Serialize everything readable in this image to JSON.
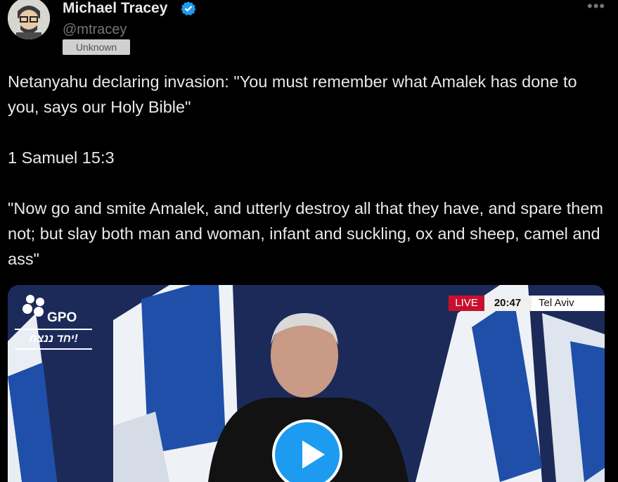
{
  "author": {
    "name": "Michael Tracey",
    "handle": "@mtracey",
    "badge": "Unknown",
    "avatar_icon": "avatar-illustration-icon",
    "verified_icon": "verified-badge-icon"
  },
  "menu": {
    "more_label": "•••"
  },
  "tweet": {
    "line1": "Netanyahu declaring invasion: \"You must remember what Amalek has done to you, says our Holy Bible\"",
    "line2": "1 Samuel 15:3",
    "line3": "\"Now go and smite Amalek, and utterly destroy all that they have, and spare them not; but slay both man and woman, infant and suckling, ox and sheep, camel and ass\""
  },
  "media": {
    "gpo_label": "GPO",
    "hebrew_banner": "יחד ננצח!",
    "live_label": "LIVE",
    "time": "20:47",
    "city": "Tel Aviv",
    "play_icon": "play-icon"
  },
  "colors": {
    "accent": "#1d9bf0",
    "live_red": "#c8102e",
    "flag_blue": "#1f4fa8",
    "background": "#000000"
  }
}
